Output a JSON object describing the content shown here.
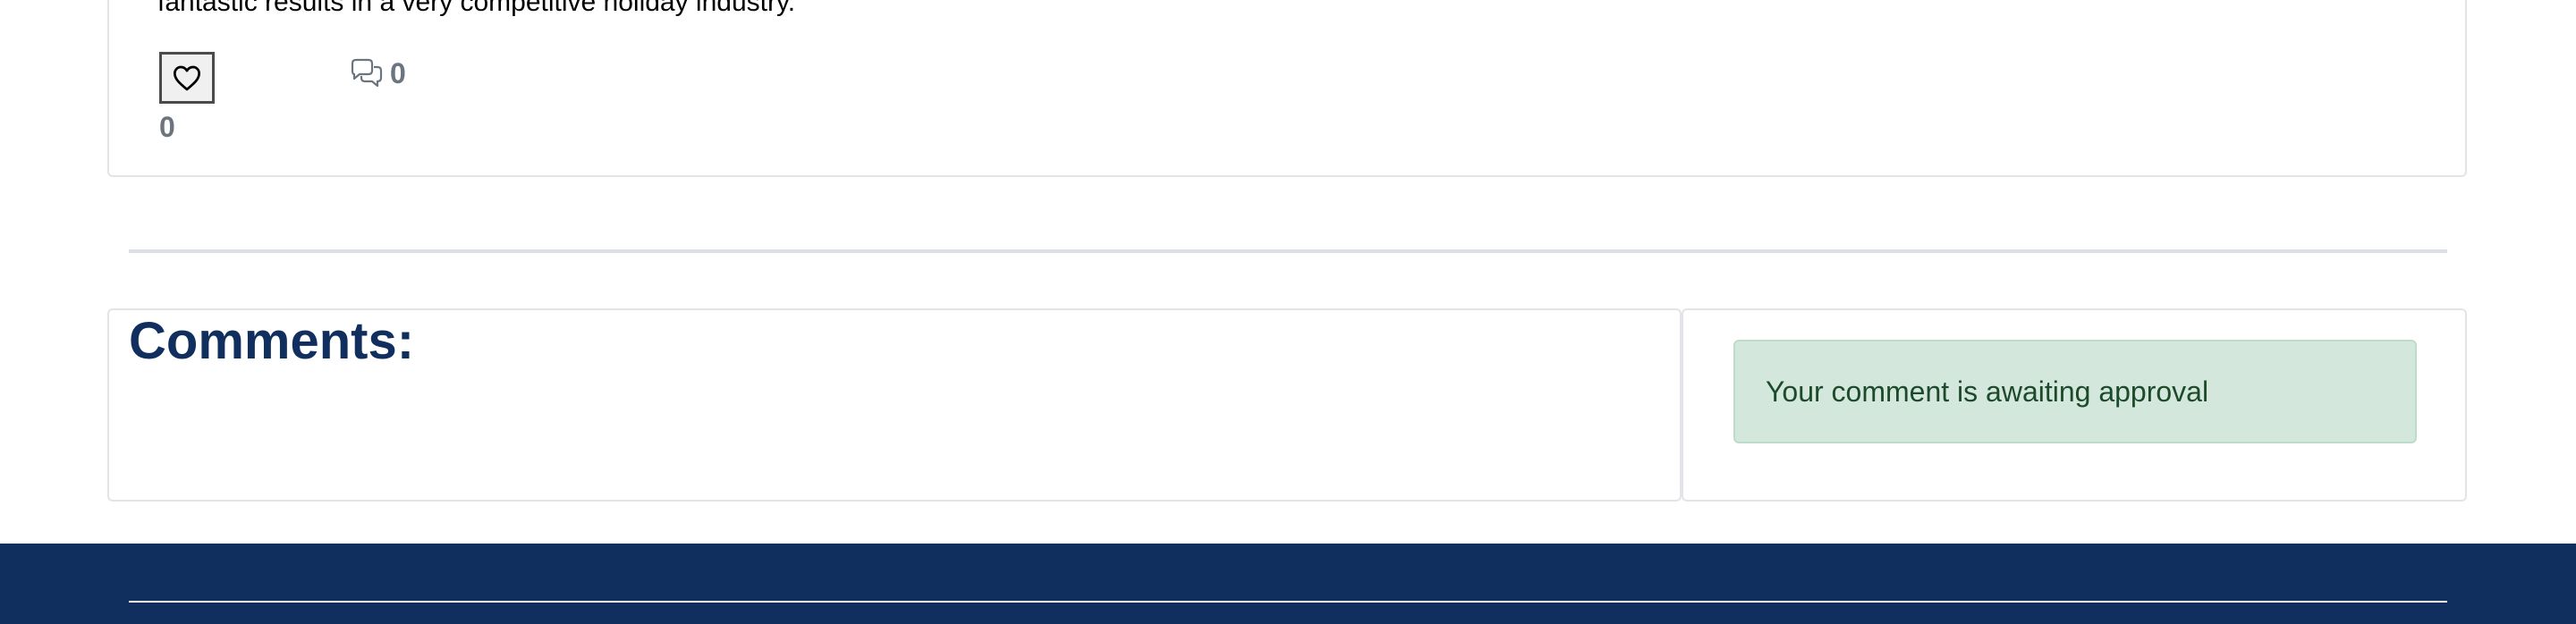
{
  "post": {
    "excerpt": "fantastic results in a very competitive holiday industry.",
    "likes": "0",
    "comments": "0"
  },
  "comments_section": {
    "title": "Comments:",
    "status_message": "Your comment is awaiting approval"
  },
  "icons": {
    "like": "heart-icon",
    "comments": "chat-bubbles-icon"
  },
  "colors": {
    "title": "#112f5e",
    "footer": "#112f5e",
    "success_bg": "#d4e7dc",
    "success_text": "#1d4a2b",
    "muted": "#6c757d"
  }
}
